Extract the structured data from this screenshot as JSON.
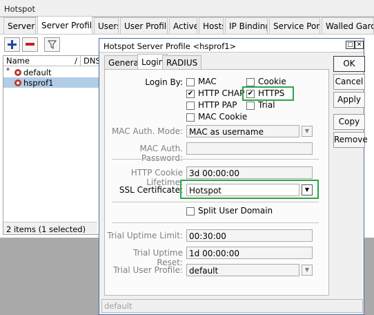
{
  "window": {
    "title": "Hotspot"
  },
  "main_tabs": [
    {
      "label": "Servers"
    },
    {
      "label": "Server Profiles"
    },
    {
      "label": "Users"
    },
    {
      "label": "User Profiles"
    },
    {
      "label": "Active"
    },
    {
      "label": "Hosts"
    },
    {
      "label": "IP Bindings"
    },
    {
      "label": "Service Ports"
    },
    {
      "label": "Walled Garden"
    }
  ],
  "list": {
    "columns": [
      "Name",
      "DNS"
    ],
    "sort_glyph": "/",
    "rows": [
      {
        "marker": "*",
        "name": "default"
      },
      {
        "marker": "",
        "name": "hsprof1"
      }
    ],
    "status": "2 items (1 selected)"
  },
  "dialog": {
    "title": "Hotspot Server Profile <hsprof1>",
    "tabs": [
      "General",
      "Login",
      "RADIUS"
    ],
    "login_by_label": "Login By:",
    "checkboxes": [
      {
        "label": "MAC",
        "checked": false
      },
      {
        "label": "Cookie",
        "checked": false
      },
      {
        "label": "HTTP CHAP",
        "checked": true
      },
      {
        "label": "HTTPS",
        "checked": true
      },
      {
        "label": "HTTP PAP",
        "checked": false
      },
      {
        "label": "Trial",
        "checked": false
      },
      {
        "label": "MAC Cookie",
        "checked": false
      }
    ],
    "mac_auth_mode_label": "MAC Auth. Mode:",
    "mac_auth_mode_value": "MAC as username",
    "mac_auth_password_label": "MAC Auth. Password:",
    "mac_auth_password_value": "",
    "http_cookie_lifetime_label": "HTTP Cookie Lifetime:",
    "http_cookie_lifetime_value": "3d 00:00:00",
    "ssl_certificate_label": "SSL Certificate:",
    "ssl_certificate_value": "Hotspot",
    "split_user_domain_label": "Split User Domain",
    "trial_uptime_limit_label": "Trial Uptime Limit:",
    "trial_uptime_limit_value": "00:30:00",
    "trial_uptime_reset_label": "Trial Uptime Reset:",
    "trial_uptime_reset_value": "1d 00:00:00",
    "trial_user_profile_label": "Trial User Profile:",
    "trial_user_profile_value": "default",
    "buttons": {
      "ok": "OK",
      "cancel": "Cancel",
      "apply": "Apply",
      "copy": "Copy",
      "remove": "Remove"
    },
    "status": "default"
  },
  "highlight_color": "#2ca44a",
  "selection_color": "#b1cde5",
  "title_bar_color": "#4b6aa0"
}
